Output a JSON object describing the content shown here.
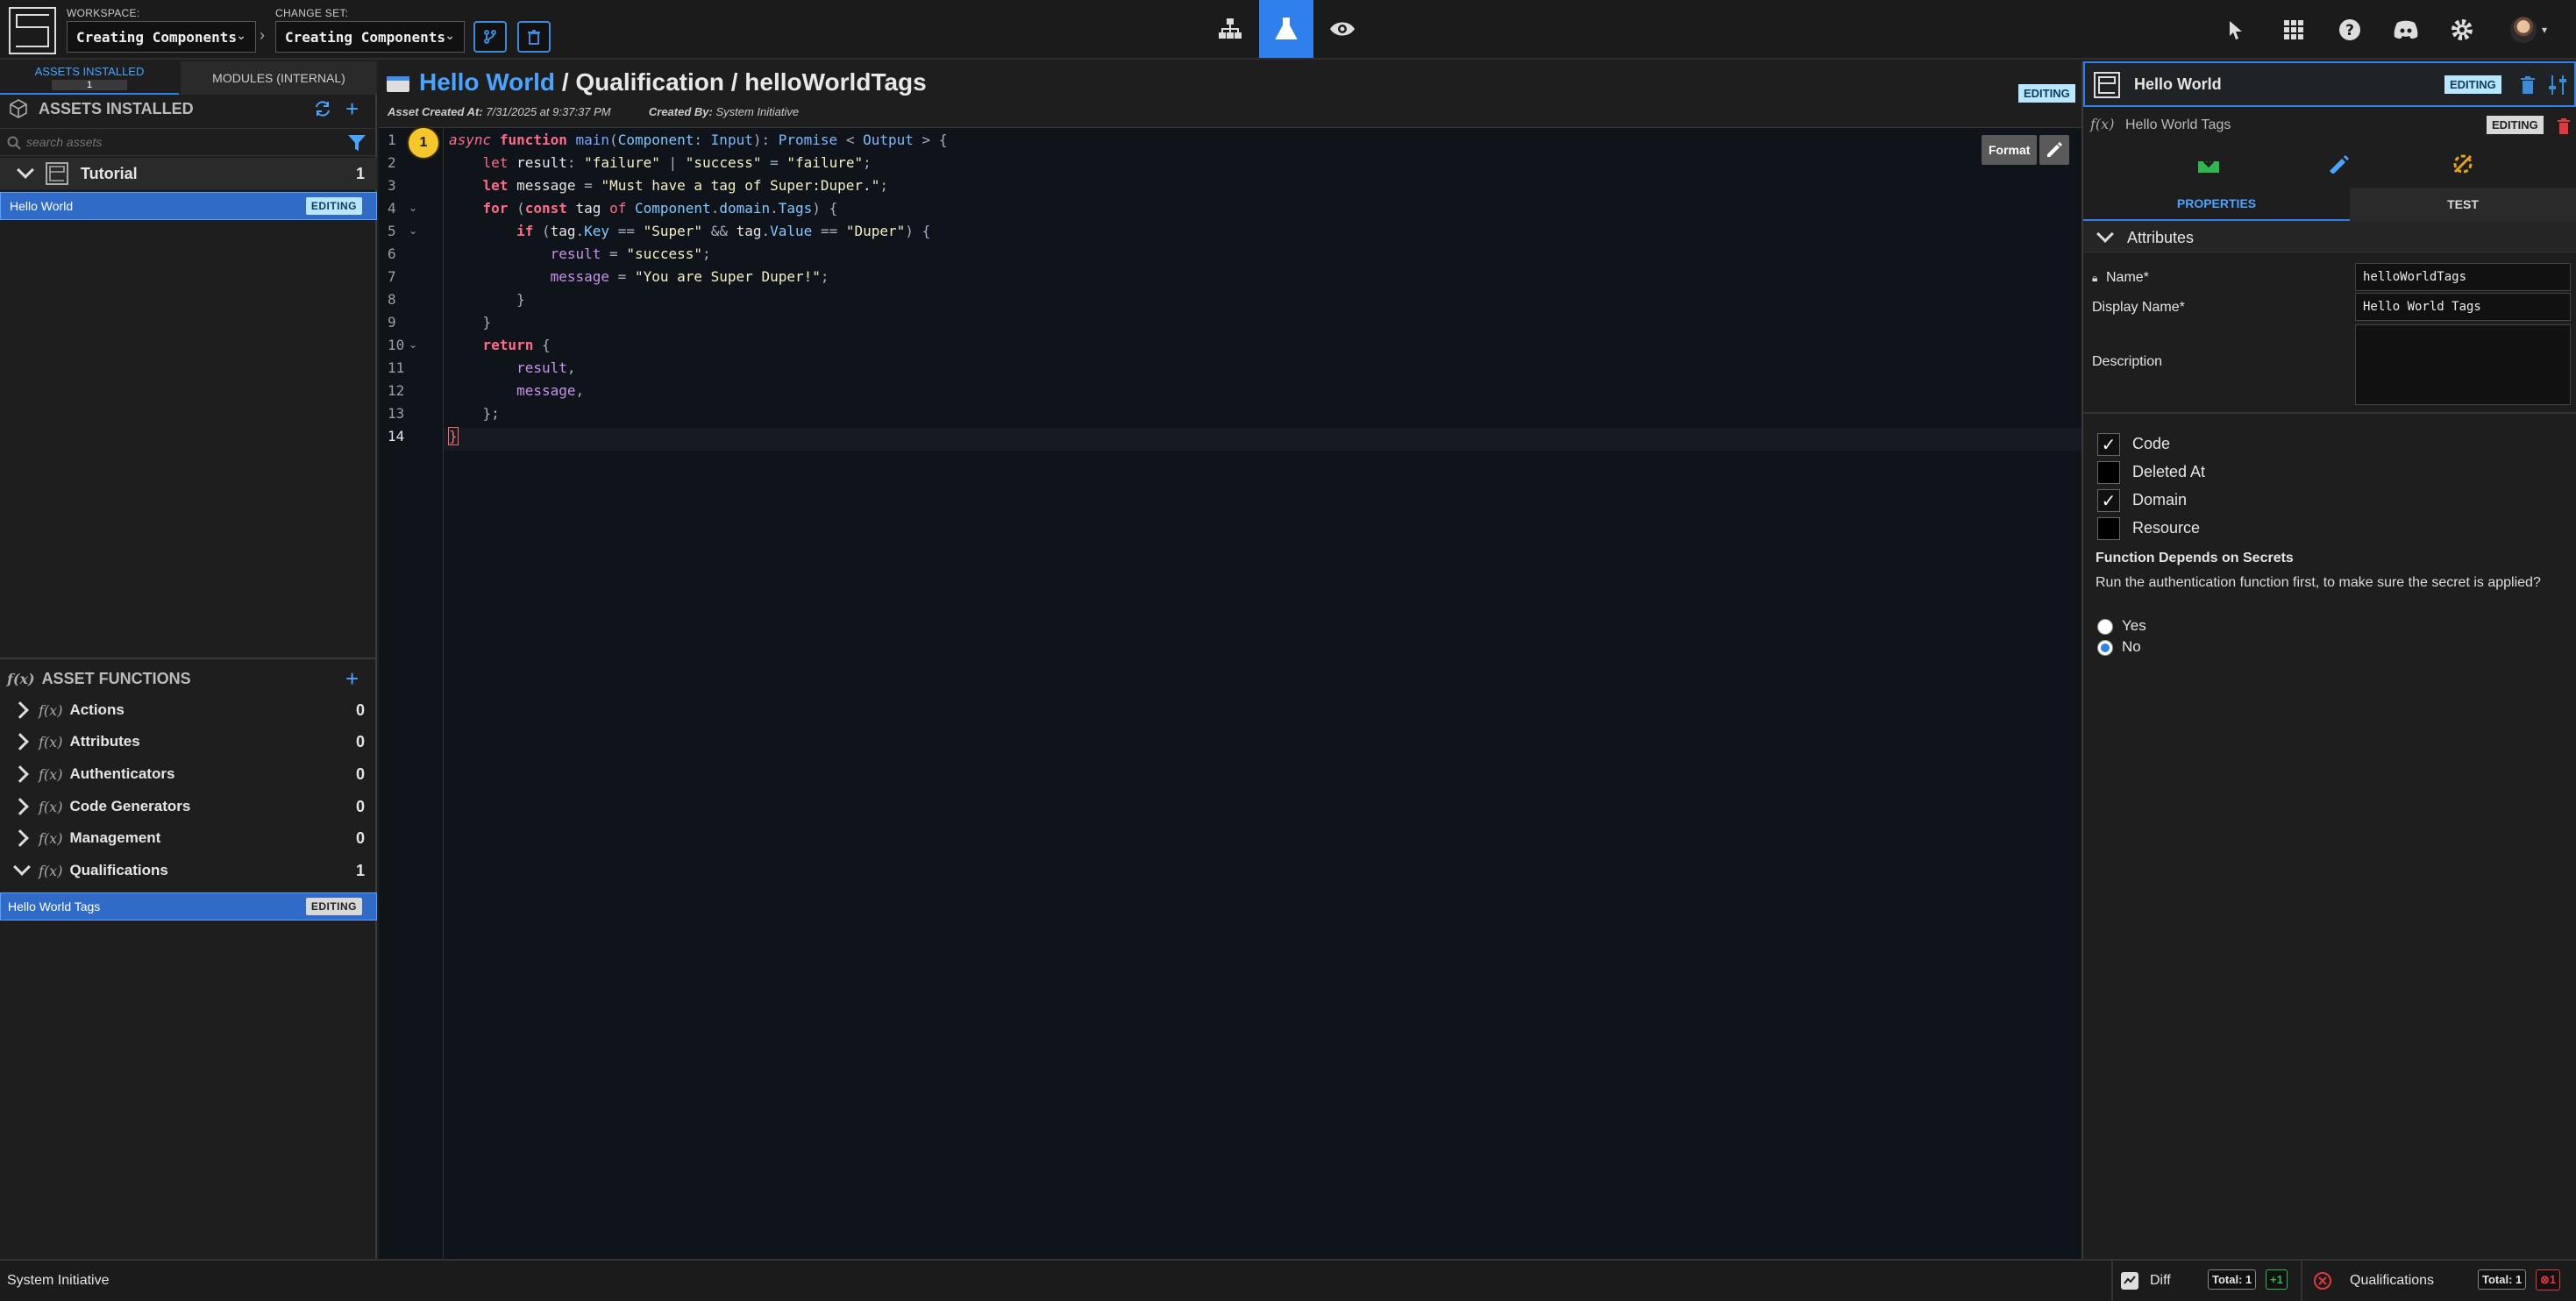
{
  "topbar": {
    "workspace_label": "WORKSPACE:",
    "workspace_value": "Creating Components",
    "changeset_label": "CHANGE SET:",
    "changeset_value": "Creating Components",
    "separator": "›"
  },
  "left": {
    "tabs": [
      {
        "label": "ASSETS INSTALLED",
        "count": "1",
        "active": true
      },
      {
        "label": "MODULES (INTERNAL)",
        "active": false
      }
    ],
    "assets_title": "ASSETS INSTALLED",
    "search_placeholder": "search assets",
    "category": {
      "name": "Tutorial",
      "count": "1"
    },
    "asset": {
      "name": "Hello World",
      "badge": "EDITING"
    },
    "functions_title": "ASSET FUNCTIONS",
    "fx_symbol": "f(x)",
    "function_groups": [
      {
        "name": "Actions",
        "count": "0"
      },
      {
        "name": "Attributes",
        "count": "0"
      },
      {
        "name": "Authenticators",
        "count": "0"
      },
      {
        "name": "Code Generators",
        "count": "0"
      },
      {
        "name": "Management",
        "count": "0"
      },
      {
        "name": "Qualifications",
        "count": "1"
      }
    ],
    "selected_function": {
      "name": "Hello World Tags",
      "badge": "EDITING"
    }
  },
  "center": {
    "breadcrumb_asset": "Hello World",
    "breadcrumb_rest": " / Qualification / helloWorldTags",
    "created_at_label": "Asset Created At:",
    "created_at_value": "7/31/2025 at 9:37:37 PM",
    "created_by_label": "Created By:",
    "created_by_value": "System Initiative",
    "badge": "EDITING",
    "format_button": "Format",
    "marker": "1",
    "line_numbers": [
      "1",
      "2",
      "3",
      "4",
      "5",
      "6",
      "7",
      "8",
      "9",
      "10",
      "11",
      "12",
      "13",
      "14"
    ],
    "fold_lines": [
      "4",
      "5",
      "10"
    ]
  },
  "right": {
    "asset_title": "Hello World",
    "asset_badge": "EDITING",
    "func_title": "Hello World Tags",
    "func_badge": "EDITING",
    "tabs": [
      {
        "label": "PROPERTIES",
        "active": true
      },
      {
        "label": "TEST",
        "active": false
      }
    ],
    "attributes_title": "Attributes",
    "name_label": "Name*",
    "name_value": "helloWorldTags",
    "display_name_label": "Display Name*",
    "display_name_value": "Hello World Tags",
    "description_label": "Description",
    "checkboxes": [
      {
        "label": "Code",
        "checked": true
      },
      {
        "label": "Deleted At",
        "checked": false
      },
      {
        "label": "Domain",
        "checked": true
      },
      {
        "label": "Resource",
        "checked": false
      }
    ],
    "secrets_title": "Function Depends on Secrets",
    "secrets_desc": "Run the authentication function first, to make sure the secret is applied?",
    "radio_yes": "Yes",
    "radio_no": "No"
  },
  "status": {
    "left_text": "System Initiative",
    "diff_label": "Diff",
    "diff_total_label": "Total: 1",
    "diff_plus": "+1",
    "qual_label": "Qualifications",
    "qual_total_label": "Total: 1",
    "qual_fail": "1"
  },
  "colors": {
    "accent_blue": "#2f80ed",
    "editing_badge": "#b9e6ff",
    "selected_row": "#2f6bc7",
    "success_green": "#2fb84f",
    "danger_red": "#e0393e"
  }
}
